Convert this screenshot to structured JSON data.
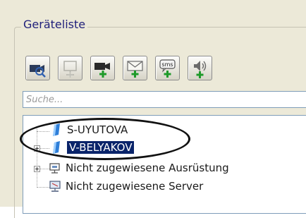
{
  "panel": {
    "title": "Geräteliste",
    "search": {
      "placeholder": "Suche..."
    },
    "toolbar": [
      {
        "name": "search-camera-button",
        "icon": "camera-search-icon",
        "enabled": true
      },
      {
        "name": "add-monitor-button",
        "icon": "monitor-add-icon",
        "enabled": false
      },
      {
        "name": "add-camera-button",
        "icon": "camera-add-icon",
        "enabled": true
      },
      {
        "name": "add-email-button",
        "icon": "envelope-add-icon",
        "enabled": true
      },
      {
        "name": "add-sms-button",
        "icon": "sms-add-icon",
        "enabled": true,
        "icon_text": "sms"
      },
      {
        "name": "add-speaker-button",
        "icon": "speaker-add-icon",
        "enabled": true
      }
    ]
  },
  "tree": {
    "items": [
      {
        "label": "S-UYUTOVA",
        "icon": "server-icon",
        "expandable": false,
        "selected": false
      },
      {
        "label": "V-BELYAKOV",
        "icon": "server-icon",
        "expandable": true,
        "selected": true
      },
      {
        "label": "Nicht zugewiesene Ausrüstung",
        "icon": "equipment-icon",
        "expandable": true,
        "selected": false
      },
      {
        "label": "Nicht zugewiesene Server",
        "icon": "monitor-icon",
        "expandable": false,
        "selected": false
      }
    ]
  },
  "colors": {
    "panel_bg": "#ece9d8",
    "selection_bg": "#0a246a",
    "add_plus": "#1f9a2a",
    "title_text": "#1f1f7a"
  }
}
